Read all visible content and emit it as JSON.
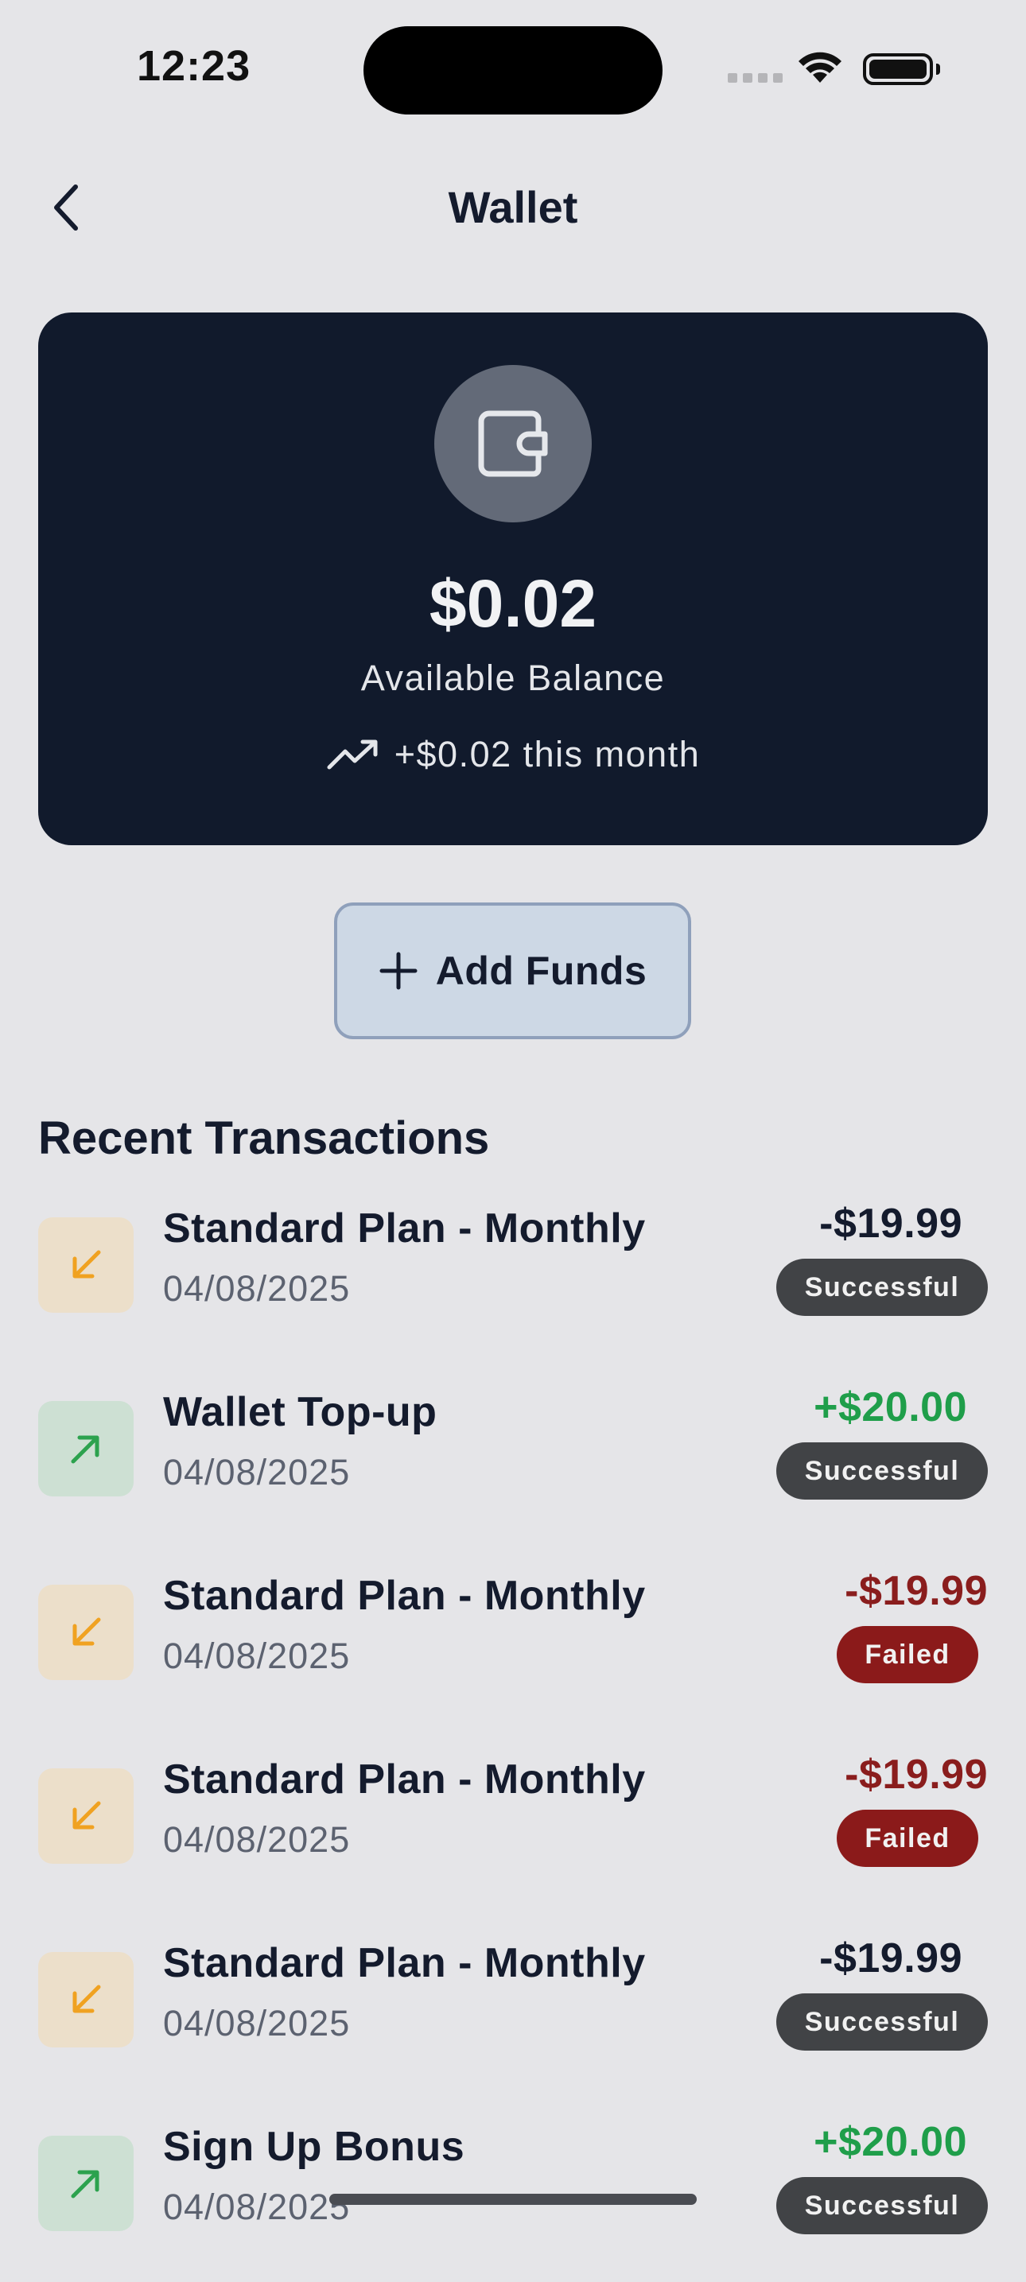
{
  "status_bar": {
    "time": "12:23"
  },
  "header": {
    "title": "Wallet",
    "back_icon": "chevron-left-icon"
  },
  "balance_card": {
    "icon": "wallet-icon",
    "amount": "$0.02",
    "label": "Available Balance",
    "trend_icon": "trending-up-icon",
    "trend_text": "+$0.02 this month"
  },
  "add_funds": {
    "icon": "plus-icon",
    "label": "Add Funds"
  },
  "transactions": {
    "section_title": "Recent Transactions",
    "items": [
      {
        "title": "Standard Plan - Monthly",
        "date": "04/08/2025",
        "amount": "-$19.99",
        "status": "Successful",
        "direction": "out",
        "icon": "arrow-down-left-icon"
      },
      {
        "title": "Wallet Top-up",
        "date": "04/08/2025",
        "amount": "+$20.00",
        "status": "Successful",
        "direction": "in",
        "icon": "arrow-up-right-icon"
      },
      {
        "title": "Standard Plan - Monthly",
        "date": "04/08/2025",
        "amount": "-$19.99",
        "status": "Failed",
        "direction": "out",
        "icon": "arrow-down-left-icon"
      },
      {
        "title": "Standard Plan - Monthly",
        "date": "04/08/2025",
        "amount": "-$19.99",
        "status": "Failed",
        "direction": "out",
        "icon": "arrow-down-left-icon"
      },
      {
        "title": "Standard Plan - Monthly",
        "date": "04/08/2025",
        "amount": "-$19.99",
        "status": "Successful",
        "direction": "out",
        "icon": "arrow-down-left-icon"
      },
      {
        "title": "Sign Up Bonus",
        "date": "04/08/2025",
        "amount": "+$20.00",
        "status": "Successful",
        "direction": "in",
        "icon": "arrow-up-right-icon"
      }
    ]
  },
  "colors": {
    "background": "#e5e5e8",
    "card": "#111a2c",
    "positive": "#1f9e4a",
    "failed": "#8a1d1d",
    "success_badge": "#414346",
    "failed_badge": "#8b1a1a",
    "incoming_icon": "#2ca24e",
    "outgoing_icon": "#f0a221"
  }
}
